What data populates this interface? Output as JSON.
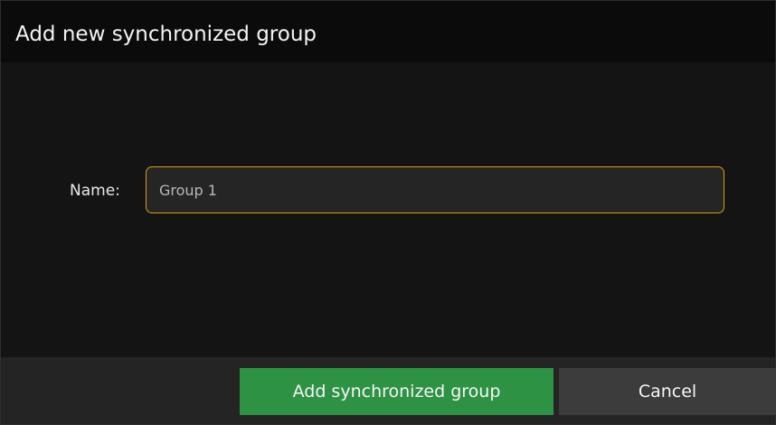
{
  "dialog": {
    "title": "Add new synchronized group",
    "name_label": "Name:",
    "name_value": "Group 1",
    "primary_button": "Add synchronized group",
    "cancel_button": "Cancel"
  },
  "colors": {
    "background": "#141414",
    "title_bar": "#0b0b0b",
    "input_border_focus": "#d79c12",
    "primary_button": "#2e9244",
    "secondary_button": "#3c3c3c"
  }
}
